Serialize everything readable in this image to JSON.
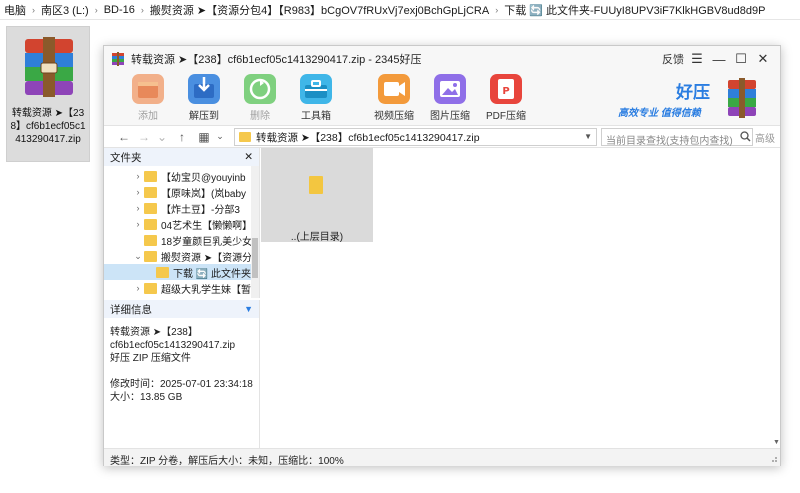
{
  "explorer": {
    "crumbs": [
      "电脑",
      "南区3 (L:)",
      "BD-16",
      "搬熨资源 ➤【资源分包4】【R983】bCgOV7fRUxVj7exj0BchGpLjCRA",
      "下载 🔄 此文件夹-FUUyI8UPV3iF7KlkHGBV8ud8d9P"
    ]
  },
  "desktop_file": {
    "label": "转载资源 ➤【238】cf6b1ecf05c1413290417.zip",
    "icon": "rar-archive-icon"
  },
  "window": {
    "title": "转载资源 ➤【238】cf6b1ecf05c1413290417.zip - 2345好压",
    "feedback_label": "反馈",
    "menu_symbol": "☰",
    "minimize_symbol": "—",
    "maximize_symbol": "☐",
    "close_symbol": "✕"
  },
  "toolbar": {
    "add_label": "添加",
    "extract_label": "解压到",
    "delete_label": "删除",
    "tools_label": "工具箱",
    "video_label": "视频压缩",
    "image_label": "图片压缩",
    "pdf_label": "PDF压缩",
    "brand_name": "好压",
    "brand_slogan": "高效专业 值得信赖"
  },
  "navbar": {
    "back_symbol": "←",
    "forward_symbol": "→",
    "dropdown_symbol": "⌄",
    "up_symbol": "↑",
    "view_symbol": "▦",
    "path": "转载资源 ➤【238】cf6b1ecf05c1413290417.zip",
    "search_placeholder": "当前目录查找(支持包内查找)",
    "advanced_label": "高级"
  },
  "folder_panel": {
    "header": "文件夹",
    "close_symbol": "✕",
    "items": [
      {
        "label": "【幼宝贝@youyinb",
        "expanded": false
      },
      {
        "label": "【原味岚】(岚baby",
        "expanded": false
      },
      {
        "label": "【炸土豆】-分部3",
        "expanded": false
      },
      {
        "label": "04艺术生【懒懒啊】",
        "expanded": false
      },
      {
        "label": "18岁童颜巨乳美少女",
        "expanded": null
      },
      {
        "label": "搬熨资源 ➤【资源分",
        "expanded": true
      },
      {
        "label": "下载 🔄 此文件夹",
        "expanded": null
      },
      {
        "label": "超级大乳学生妹【暂",
        "expanded": false
      }
    ]
  },
  "detail_panel": {
    "header": "详细信息",
    "name_line1": "转载资源 ➤【238】",
    "name_line2": "cf6b1ecf05c1413290417.zip",
    "type_text": "好压 ZIP 压缩文件",
    "modified": "修改时间：2025-07-01 23:34:18",
    "size": "大小：13.85 GB"
  },
  "files": {
    "up_label": "..(上层目录)"
  },
  "status": {
    "text": "类型：ZIP 分卷，解压后大小：未知，压缩比：100%"
  }
}
